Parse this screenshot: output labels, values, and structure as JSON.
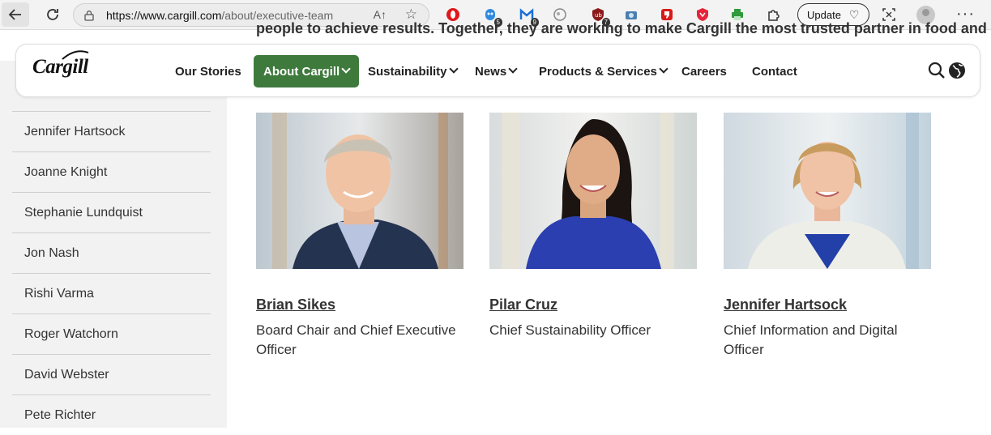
{
  "browser": {
    "url_host": "https://www.cargill.com",
    "url_path": "/about/executive-team",
    "reader_label": "A↑",
    "update_label": "Update",
    "extension_badges": [
      "5",
      "9",
      "7"
    ]
  },
  "page": {
    "peek_text": "people to achieve results. Together, they are working to make Cargill the most trusted partner in food and"
  },
  "header": {
    "logo": "Cargill",
    "nav": [
      {
        "label": "Our Stories"
      },
      {
        "label": "About Cargill",
        "active": true
      },
      {
        "label": "Sustainability"
      },
      {
        "label": "News"
      },
      {
        "label": "Products & Services"
      },
      {
        "label": "Careers"
      },
      {
        "label": "Contact"
      }
    ]
  },
  "sidebar": {
    "items": [
      {
        "label": "Jennifer Hartsock"
      },
      {
        "label": "Joanne Knight"
      },
      {
        "label": "Stephanie Lundquist"
      },
      {
        "label": "Jon Nash"
      },
      {
        "label": "Rishi Varma"
      },
      {
        "label": "Roger Watchorn"
      },
      {
        "label": "David Webster"
      },
      {
        "label": "Pete Richter"
      }
    ]
  },
  "executives": [
    {
      "name": "Brian Sikes",
      "title": "Board Chair and Chief Executive Officer"
    },
    {
      "name": "Pilar Cruz",
      "title": "Chief Sustainability Officer"
    },
    {
      "name": "Jennifer Hartsock",
      "title": "Chief Information and Digital Officer"
    }
  ],
  "colors": {
    "brand_green": "#3f7a3d",
    "text": "#333333"
  }
}
